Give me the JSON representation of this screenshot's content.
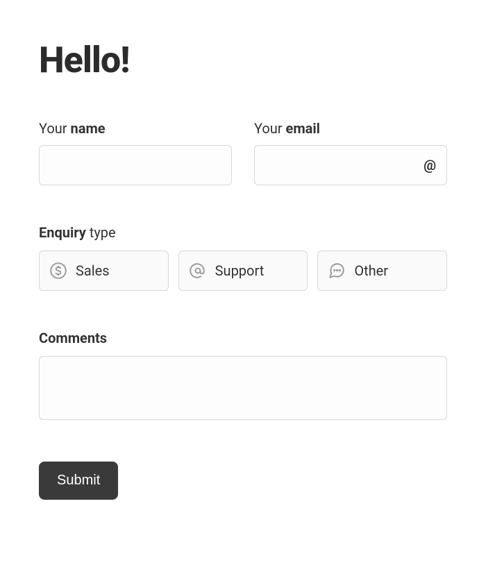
{
  "title": "Hello!",
  "fields": {
    "name": {
      "label_prefix": "Your ",
      "label_bold": "name",
      "value": ""
    },
    "email": {
      "label_prefix": "Your ",
      "label_bold": "email",
      "value": ""
    }
  },
  "enquiry": {
    "label_bold": "Enquiry",
    "label_suffix": " type",
    "options": [
      {
        "label": "Sales"
      },
      {
        "label": "Support"
      },
      {
        "label": "Other"
      }
    ]
  },
  "comments": {
    "label": "Comments",
    "value": ""
  },
  "submit_label": "Submit"
}
